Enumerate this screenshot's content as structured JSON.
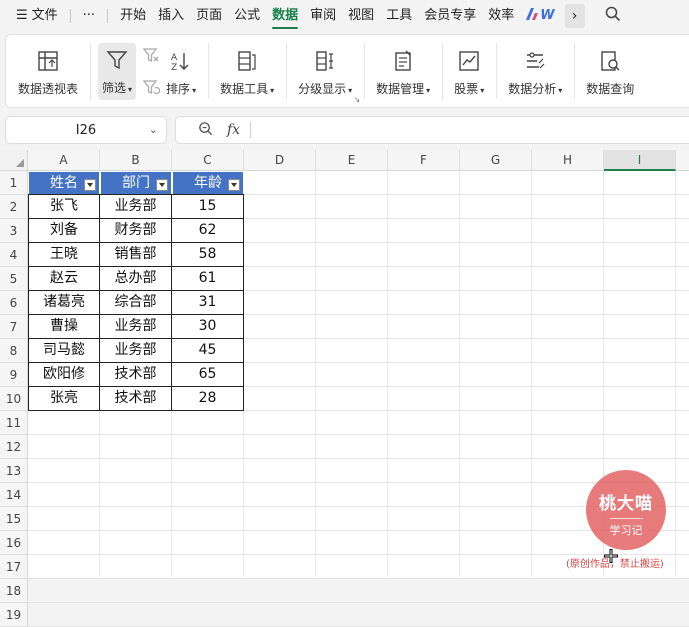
{
  "menubar": {
    "hamburger": "☰",
    "file_label": "文件",
    "more": "···",
    "tabs": [
      "开始",
      "插入",
      "页面",
      "公式",
      "数据",
      "审阅",
      "视图",
      "工具",
      "会员专享",
      "效率"
    ],
    "active_tab": "数据",
    "wps_label": "W",
    "chevron": "›",
    "search_icon": "search-icon"
  },
  "ribbon": {
    "pivot_label": "数据透视表",
    "filter_label": "筛选",
    "sort_label": "排序",
    "datatools_label": "数据工具",
    "outline_label": "分级显示",
    "datamgmt_label": "数据管理",
    "stocks_label": "股票",
    "analysis_label": "数据分析",
    "query_label": "数据查询"
  },
  "formula_bar": {
    "cell_ref": "I26",
    "fx_label": "fx",
    "formula": ""
  },
  "grid": {
    "columns": [
      "A",
      "B",
      "C",
      "D",
      "E",
      "F",
      "G",
      "H",
      "I"
    ],
    "selected_column": "I",
    "rows": [
      "1",
      "2",
      "3",
      "4",
      "5",
      "6",
      "7",
      "8",
      "9",
      "10",
      "11",
      "12",
      "13",
      "14",
      "15",
      "16",
      "17",
      "18",
      "19"
    ]
  },
  "table": {
    "headers": [
      "姓名",
      "部门",
      "年龄"
    ],
    "rows": [
      [
        "张飞",
        "业务部",
        "15"
      ],
      [
        "刘备",
        "财务部",
        "62"
      ],
      [
        "王晓",
        "销售部",
        "58"
      ],
      [
        "赵云",
        "总办部",
        "61"
      ],
      [
        "诸葛亮",
        "综合部",
        "31"
      ],
      [
        "曹操",
        "业务部",
        "30"
      ],
      [
        "司马懿",
        "业务部",
        "45"
      ],
      [
        "欧阳修",
        "技术部",
        "65"
      ],
      [
        "张亮",
        "技术部",
        "28"
      ]
    ],
    "header_color": "#4472c4"
  },
  "watermark": {
    "title": "桃大喵",
    "subtitle": "学习记",
    "note": "(原创作品，禁止搬运)",
    "color": "#e25e5e"
  }
}
